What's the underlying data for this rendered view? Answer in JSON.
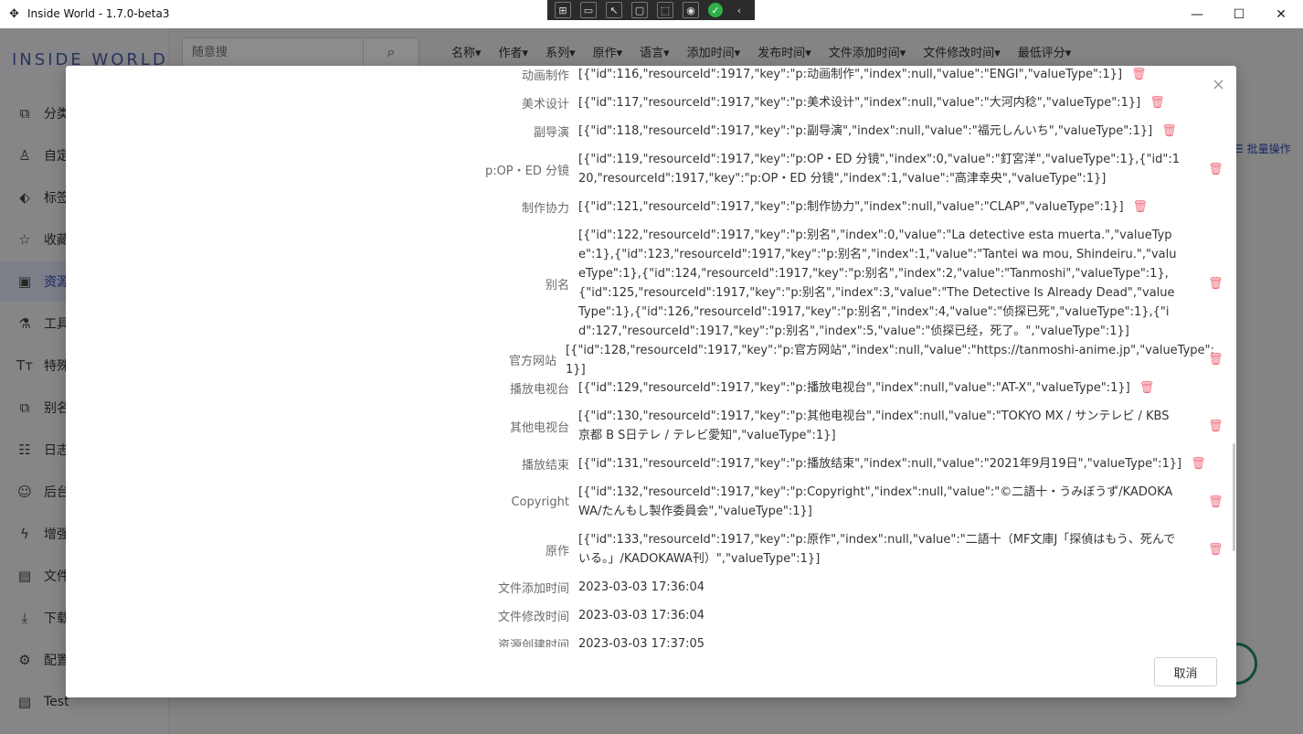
{
  "window": {
    "title": "Inside World - 1.7.0-beta3",
    "buttons": {
      "minimize": "—",
      "maximize": "☐",
      "close": "✕"
    }
  },
  "devtools": {
    "icons": [
      "inspect-icon",
      "device-icon",
      "pointer-icon",
      "frame-icon",
      "select-icon",
      "signal-icon",
      "check-icon",
      "chevron-left-icon"
    ]
  },
  "sidebar": {
    "logo": "INSIDE WORLD",
    "items": [
      {
        "label": "分类",
        "icon": "category-icon"
      },
      {
        "label": "自定",
        "icon": "person-icon"
      },
      {
        "label": "标签",
        "icon": "tag-icon"
      },
      {
        "label": "收藏",
        "icon": "star-icon"
      },
      {
        "label": "资源",
        "icon": "image-icon",
        "active": true
      },
      {
        "label": "工具",
        "icon": "flask-icon"
      },
      {
        "label": "特殊",
        "icon": "text-icon"
      },
      {
        "label": "别名",
        "icon": "alias-icon"
      },
      {
        "label": "日志",
        "icon": "log-icon"
      },
      {
        "label": "后台",
        "icon": "background-icon"
      },
      {
        "label": "增强",
        "icon": "lightning-icon"
      },
      {
        "label": "文件",
        "icon": "folder-icon"
      },
      {
        "label": "下载",
        "icon": "download-icon"
      },
      {
        "label": "配置",
        "icon": "gear-icon"
      },
      {
        "label": "Test",
        "icon": "folder-icon"
      }
    ]
  },
  "search": {
    "placeholder": "随意搜"
  },
  "filters": [
    "名称▾",
    "作者▾",
    "系列▾",
    "原作▾",
    "语言▾",
    "添加时间▾",
    "发布时间▾",
    "文件添加时间▾",
    "文件修改时间▾",
    "最低评分▾"
  ],
  "batch_label": "☰ 批量操作",
  "modal": {
    "close": "×",
    "cancel": "取消",
    "rows": [
      {
        "key": "动画制作",
        "value": "[{\"id\":116,\"resourceId\":1917,\"key\":\"p:动画制作\",\"index\":null,\"value\":\"ENGI\",\"valueType\":1}]"
      },
      {
        "key": "美术设计",
        "value": "[{\"id\":117,\"resourceId\":1917,\"key\":\"p:美术设计\",\"index\":null,\"value\":\"大河内稔\",\"valueType\":1}]"
      },
      {
        "key": "副导演",
        "value": "[{\"id\":118,\"resourceId\":1917,\"key\":\"p:副导演\",\"index\":null,\"value\":\"福元しんいち\",\"valueType\":1}]"
      },
      {
        "key": "p:OP・ED 分镜",
        "value": "[{\"id\":119,\"resourceId\":1917,\"key\":\"p:OP・ED 分镜\",\"index\":0,\"value\":\"釘宮洋\",\"valueType\":1},{\"id\":120,\"resourceId\":1917,\"key\":\"p:OP・ED 分镜\",\"index\":1,\"value\":\"高津幸央\",\"valueType\":1}]"
      },
      {
        "key": "制作协力",
        "value": "[{\"id\":121,\"resourceId\":1917,\"key\":\"p:制作协力\",\"index\":null,\"value\":\"CLAP\",\"valueType\":1}]"
      },
      {
        "key": "别名",
        "value": "[{\"id\":122,\"resourceId\":1917,\"key\":\"p:别名\",\"index\":0,\"value\":\"La detective esta muerta.\",\"valueType\":1},{\"id\":123,\"resourceId\":1917,\"key\":\"p:别名\",\"index\":1,\"value\":\"Tantei wa mou, Shindeiru.\",\"valueType\":1},{\"id\":124,\"resourceId\":1917,\"key\":\"p:别名\",\"index\":2,\"value\":\"Tanmoshi\",\"valueType\":1},{\"id\":125,\"resourceId\":1917,\"key\":\"p:别名\",\"index\":3,\"value\":\"The Detective Is Already Dead\",\"valueType\":1},{\"id\":126,\"resourceId\":1917,\"key\":\"p:别名\",\"index\":4,\"value\":\"侦探已死\",\"valueType\":1},{\"id\":127,\"resourceId\":1917,\"key\":\"p:别名\",\"index\":5,\"value\":\"侦探已经，死了。\",\"valueType\":1}]"
      },
      {
        "key": "官方网站",
        "value": "[{\"id\":128,\"resourceId\":1917,\"key\":\"p:官方网站\",\"index\":null,\"value\":\"https://tanmoshi-anime.jp\",\"valueType\":1}]"
      },
      {
        "key": "播放电视台",
        "value": "[{\"id\":129,\"resourceId\":1917,\"key\":\"p:播放电视台\",\"index\":null,\"value\":\"AT-X\",\"valueType\":1}]"
      },
      {
        "key": "其他电视台",
        "value": "[{\"id\":130,\"resourceId\":1917,\"key\":\"p:其他电视台\",\"index\":null,\"value\":\"TOKYO MX / サンテレビ / KBS京都 B S日テレ / テレビ愛知\",\"valueType\":1}]"
      },
      {
        "key": "播放结束",
        "value": "[{\"id\":131,\"resourceId\":1917,\"key\":\"p:播放结束\",\"index\":null,\"value\":\"2021年9月19日\",\"valueType\":1}]"
      },
      {
        "key": "Copyright",
        "value": "[{\"id\":132,\"resourceId\":1917,\"key\":\"p:Copyright\",\"index\":null,\"value\":\"©二語十・うみぼうず/KADOKAWA/たんもし製作委員会\",\"valueType\":1}]"
      },
      {
        "key": "原作",
        "value": "[{\"id\":133,\"resourceId\":1917,\"key\":\"p:原作\",\"index\":null,\"value\":\"二語十（MF文庫J「探偵はもう、死んでいる。」/KADOKAWA刊）\",\"valueType\":1}]"
      },
      {
        "key": "文件添加时间",
        "value": "2023-03-03 17:36:04"
      },
      {
        "key": "文件修改时间",
        "value": "2023-03-03 17:36:04"
      },
      {
        "key": "资源创建时间",
        "value": "2023-03-03 17:37:05"
      }
    ]
  },
  "colors": {
    "accent": "#2a4bb5",
    "delete": "#f06a7a",
    "fab": "#1a8c6a"
  }
}
